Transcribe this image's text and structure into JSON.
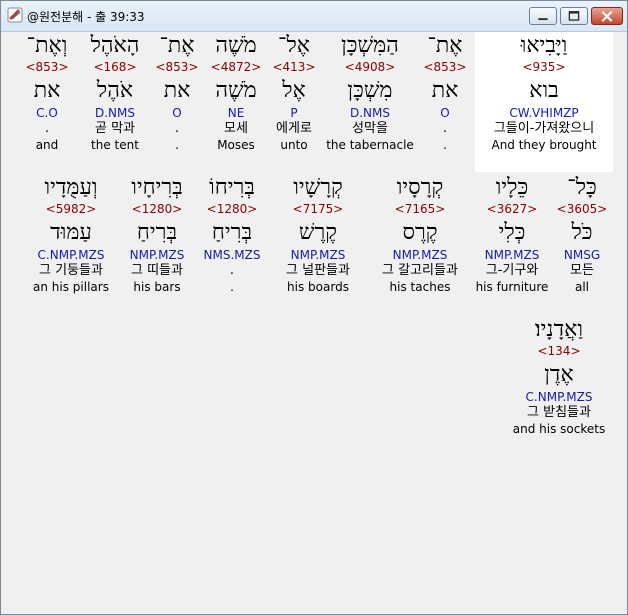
{
  "window": {
    "title": "@원전분해 - 출 39:33"
  },
  "rows": [
    [
      {
        "hebrew": "וַיָּבִיאוּ",
        "strong": "<935>",
        "root": "בוא",
        "parse": "CW.VHIMZP",
        "korean": "그들이-가져왔으니",
        "english": "And they brought",
        "highlight": true
      },
      {
        "hebrew": "אֶת־",
        "strong": "<853>",
        "root": "את",
        "parse": "O",
        "korean": ".",
        "english": ".",
        "highlight": false
      },
      {
        "hebrew": "הַמִּשְׁכָּן",
        "strong": "<4908>",
        "root": "מִשְׁכָּן",
        "parse": "D.NMS",
        "korean": "성막을",
        "english": "the tabernacle",
        "highlight": false
      },
      {
        "hebrew": "אֶל־",
        "strong": "<413>",
        "root": "אֶל",
        "parse": "P",
        "korean": "에게로",
        "english": "unto",
        "highlight": false
      },
      {
        "hebrew": "מֹשֶׁה",
        "strong": "<4872>",
        "root": "מֹשֶׁה",
        "parse": "NE",
        "korean": "모세",
        "english": "Moses",
        "highlight": false
      },
      {
        "hebrew": "אֶת־",
        "strong": "<853>",
        "root": "את",
        "parse": "O",
        "korean": ".",
        "english": ".",
        "highlight": false
      },
      {
        "hebrew": "הָאֹהֶל",
        "strong": "<168>",
        "root": "אֹהֶל",
        "parse": "D.NMS",
        "korean": "곧 막과",
        "english": "the tent",
        "highlight": false
      },
      {
        "hebrew": "וְאֶת־",
        "strong": "<853>",
        "root": "את",
        "parse": "C.O",
        "korean": ".",
        "english": "and",
        "highlight": false
      }
    ],
    [
      {
        "hebrew": "כָּל־",
        "strong": "<3605>",
        "root": "כֹּל",
        "parse": "NMSG",
        "korean": "모든",
        "english": "all",
        "highlight": false
      },
      {
        "hebrew": "כֵּלָיו",
        "strong": "<3627>",
        "root": "כְּלִי",
        "parse": "NMP.MZS",
        "korean": "그-기구와",
        "english": "his furniture",
        "highlight": false
      },
      {
        "hebrew": "קְרָסָיו",
        "strong": "<7165>",
        "root": "קֶרֶס",
        "parse": "NMP.MZS",
        "korean": "그 갈고리들과",
        "english": "his taches",
        "highlight": false
      },
      {
        "hebrew": "קְרָשָׁיו",
        "strong": "<7175>",
        "root": "קֶרֶשׁ",
        "parse": "NMP.MZS",
        "korean": "그 널판들과",
        "english": "his boards",
        "highlight": false
      },
      {
        "hebrew": "בְּרִיחוֹ",
        "strong": "<1280>",
        "root": "בְּרִיחַ",
        "parse": "NMS.MZS",
        "korean": ".",
        "english": ".",
        "highlight": false
      },
      {
        "hebrew": "בְּרִיחָיו",
        "strong": "<1280>",
        "root": "בְּרִיחַ",
        "parse": "NMP.MZS",
        "korean": "그 띠들과",
        "english": "his bars",
        "highlight": false
      },
      {
        "hebrew": "וְעַמֻּדָיו",
        "strong": "<5982>",
        "root": "עַמּוּד",
        "parse": "C.NMP.MZS",
        "korean": "그 기둥들과",
        "english": "an his pillars",
        "highlight": false
      }
    ],
    [
      {
        "hebrew": "וַאֲדָנָיו׃",
        "strong": "<134>",
        "root": "אֶדֶן",
        "parse": "C.NMP.MZS",
        "korean": "그 받침들과",
        "english": "and his sockets",
        "highlight": false
      }
    ]
  ]
}
